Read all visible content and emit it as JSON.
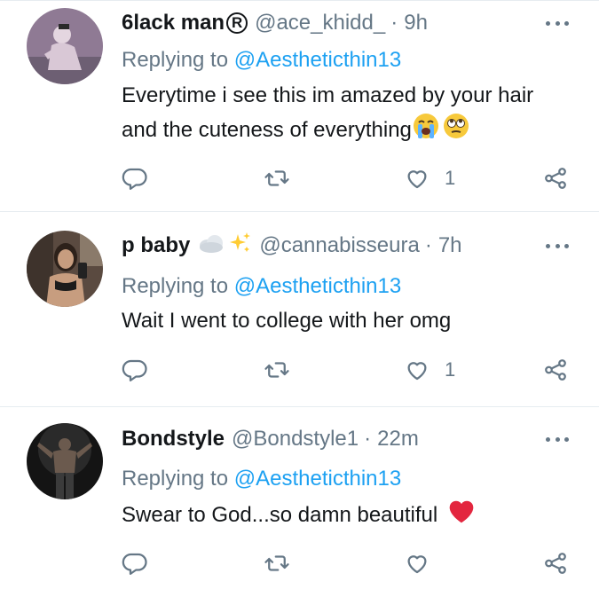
{
  "tweets": [
    {
      "name": "6lack man",
      "name_badge": "®",
      "handle": "@ace_khidd_",
      "time": "9h",
      "reply_prefix": "Replying to",
      "reply_to": "@Aestheticthin13",
      "text_line1": "Everytime i see this im amazed by your hair",
      "text_line2": "and the cuteness of everything",
      "emojis": [
        "loudly-crying-face",
        "face-with-rolling-eyes"
      ],
      "likes": "1",
      "avatar_colors": {
        "bg": "#8f7a94",
        "figure": "#d9c8d6"
      }
    },
    {
      "name": "p baby",
      "name_emojis": [
        "cloud",
        "sparkles"
      ],
      "handle": "@cannabisseura",
      "time": "7h",
      "reply_prefix": "Replying to",
      "reply_to": "@Aestheticthin13",
      "text_line1": "Wait I went to college with her omg",
      "likes": "1",
      "avatar_colors": {
        "bg": "#5a4a40",
        "figure": "#c79d7f"
      }
    },
    {
      "name": "Bondstyle",
      "handle": "@Bondstyle1",
      "time": "22m",
      "reply_prefix": "Replying to",
      "reply_to": "@Aestheticthin13",
      "text_line1": "Swear to God...so damn beautiful",
      "emojis": [
        "red-heart"
      ],
      "likes": "",
      "avatar_colors": {
        "bg": "#141414",
        "figure": "#6b5a4e"
      }
    }
  ],
  "separator": "·",
  "icons": [
    "reply-icon",
    "retweet-icon",
    "like-icon",
    "share-icon",
    "more-icon"
  ],
  "colors": {
    "link": "#1da1f2",
    "secondary": "#657786",
    "text": "#14171a",
    "divider": "#e6ecf0",
    "heart": "#e0245e"
  }
}
